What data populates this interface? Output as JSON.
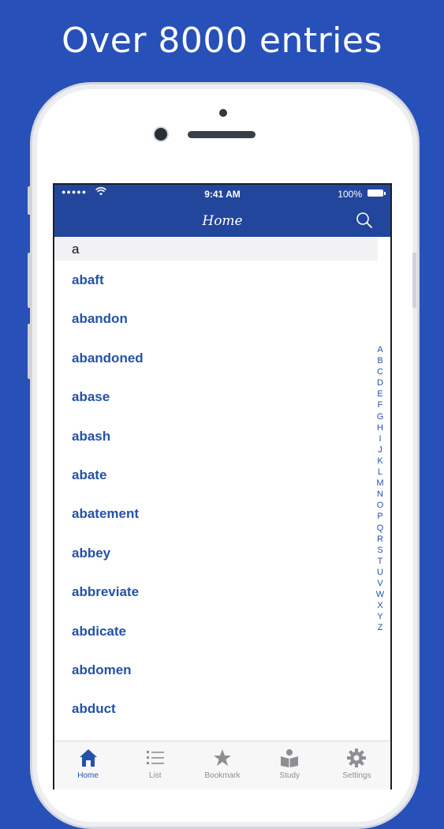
{
  "headline": "Over 8000 entries",
  "status_bar": {
    "signal": "●●●●●",
    "wifi": "wifi",
    "time": "9:41 AM",
    "battery": "100%"
  },
  "nav": {
    "title": "Home",
    "search_icon": "search-icon"
  },
  "section_header": "a",
  "entries": [
    "abaft",
    "abandon",
    "abandoned",
    "abase",
    "abash",
    "abate",
    "abatement",
    "abbey",
    "abbreviate",
    "abdicate",
    "abdomen",
    "abduct"
  ],
  "alphabet_index": [
    "A",
    "B",
    "C",
    "D",
    "E",
    "F",
    "G",
    "H",
    "I",
    "J",
    "K",
    "L",
    "M",
    "N",
    "O",
    "P",
    "Q",
    "R",
    "S",
    "T",
    "U",
    "V",
    "W",
    "X",
    "Y",
    "Z"
  ],
  "tabs": [
    {
      "label": "Home",
      "icon": "home-icon",
      "active": true
    },
    {
      "label": "List",
      "icon": "list-icon",
      "active": false
    },
    {
      "label": "Bookmark",
      "icon": "star-icon",
      "active": false
    },
    {
      "label": "Study",
      "icon": "reading-icon",
      "active": false
    },
    {
      "label": "Settings",
      "icon": "gear-icon",
      "active": false
    }
  ],
  "colors": {
    "background": "#2750b8",
    "nav_bar": "#22469b",
    "accent": "#2452a9",
    "tab_inactive": "#8e8e93"
  }
}
